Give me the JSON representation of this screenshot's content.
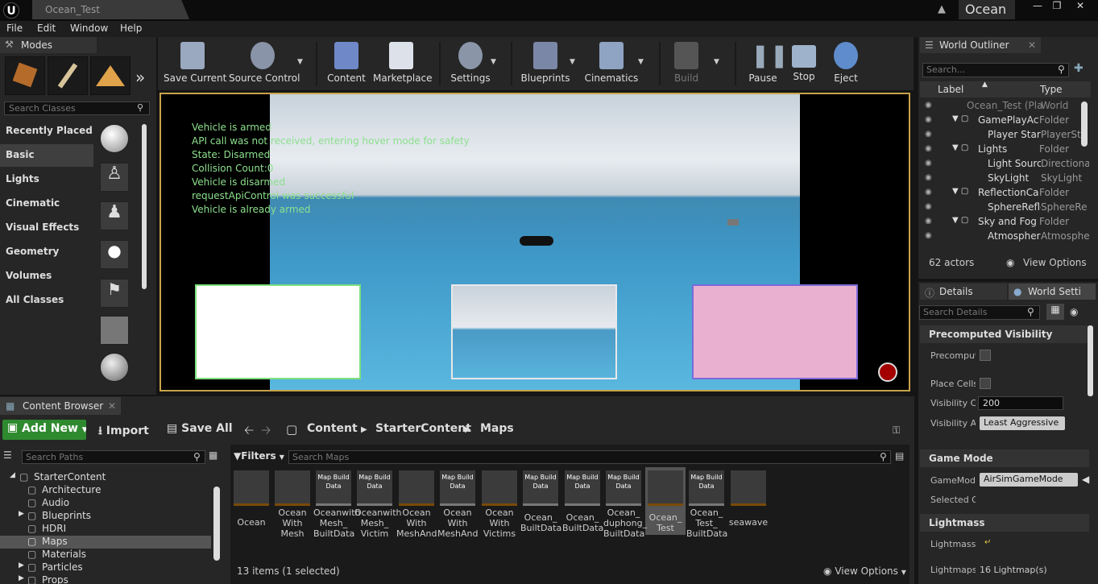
{
  "title_bar": {
    "logo": "U",
    "doc_tab": "Ocean_Test",
    "project": "Ocean"
  },
  "menu": [
    "File",
    "Edit",
    "Window",
    "Help"
  ],
  "modes": {
    "tab": "Modes",
    "search_placeholder": "Search Classes",
    "categories": [
      "Recently Placed",
      "Basic",
      "Lights",
      "Cinematic",
      "Visual Effects",
      "Geometry",
      "Volumes",
      "All Classes"
    ],
    "selected_category": "Basic"
  },
  "toolbar": {
    "buttons": [
      "Save Current",
      "Source Control",
      "Content",
      "Marketplace",
      "Settings",
      "Blueprints",
      "Cinematics",
      "Build",
      "Pause",
      "Stop",
      "Eject"
    ]
  },
  "viewport": {
    "debug_lines": [
      "Vehicle is armed",
      "API call was not received, entering hover mode for safety",
      "State: Disarmed",
      "Collision Count:0",
      "Vehicle is disarmed",
      "requestApiControl was successful",
      "Vehicle is already armed"
    ]
  },
  "outliner": {
    "tab": "World Outliner",
    "search_placeholder": "Search...",
    "col_label": "Label",
    "col_type": "Type",
    "rows": [
      {
        "label": "Ocean_Test (Pla",
        "type": "World"
      },
      {
        "label": "GamePlayActo",
        "type": "Folder"
      },
      {
        "label": "Player Start",
        "type": "PlayerSta"
      },
      {
        "label": "Lights",
        "type": "Folder"
      },
      {
        "label": "Light Source",
        "type": "Directiona"
      },
      {
        "label": "SkyLight",
        "type": "SkyLight"
      },
      {
        "label": "ReflectionCap",
        "type": "Folder"
      },
      {
        "label": "SphereReflec",
        "type": "SphereRe"
      },
      {
        "label": "Sky and Fog",
        "type": "Folder"
      },
      {
        "label": "Atmospheri",
        "type": "Atmosphe"
      }
    ],
    "count": "62 actors",
    "view_options": "View Options"
  },
  "details": {
    "tab_details": "Details",
    "tab_world": "World Setti",
    "search_placeholder": "Search Details",
    "section_precomputed": "Precomputed Visibility",
    "prop_precompute": "Precompute",
    "prop_place_cells": "Place Cells",
    "prop_visibility_cell": "Visibility Ce",
    "visibility_cell_value": "200",
    "prop_visibility_agg": "Visibility Ag",
    "visibility_agg_value": "Least Aggressive",
    "section_game_mode": "Game Mode",
    "prop_gamemode": "GameMode",
    "gamemode_value": "AirSimGameMode",
    "prop_selected": "Selected G",
    "section_lightmass": "Lightmass",
    "prop_lightmass": "Lightmass",
    "prop_lightmaps": "Lightmaps",
    "lightmaps_value": "16 Lightmap(s)"
  },
  "content_browser": {
    "tab": "Content Browser",
    "add_new": "Add New",
    "import": "Import",
    "save_all": "Save All",
    "breadcrumb": [
      "Content",
      "StarterContent",
      "Maps"
    ],
    "paths_placeholder": "Search Paths",
    "tree": [
      "StarterContent",
      "Architecture",
      "Audio",
      "Blueprints",
      "HDRI",
      "Maps",
      "Materials",
      "Particles",
      "Props"
    ],
    "tree_selected": "Maps",
    "filters": "Filters",
    "search_placeholder": "Search Maps",
    "assets": [
      {
        "thumb": "",
        "label": "Ocean"
      },
      {
        "thumb": "",
        "label": "Ocean With Mesh"
      },
      {
        "thumb": "Map Build Data",
        "label": "Oceanwith Mesh_ BuiltData"
      },
      {
        "thumb": "Map Build Data",
        "label": "Oceanwith Mesh_ Victim"
      },
      {
        "thumb": "",
        "label": "Ocean With MeshAnd"
      },
      {
        "thumb": "Map Build Data",
        "label": "Ocean With MeshAnd"
      },
      {
        "thumb": "",
        "label": "Ocean With Victims"
      },
      {
        "thumb": "Map Build Data",
        "label": "Ocean_ BuiltData"
      },
      {
        "thumb": "Map Build Data",
        "label": "Ocean_ BuiltData"
      },
      {
        "thumb": "Map Build Data",
        "label": "Ocean_ duphong_ BuiltData"
      },
      {
        "thumb": "",
        "label": "Ocean_ Test"
      },
      {
        "thumb": "Map Build Data",
        "label": "Ocean_ Test_ BuiltData"
      },
      {
        "thumb": "",
        "label": "seawave"
      }
    ],
    "item_count": "13 items (1 selected)",
    "view_options": "View Options"
  }
}
